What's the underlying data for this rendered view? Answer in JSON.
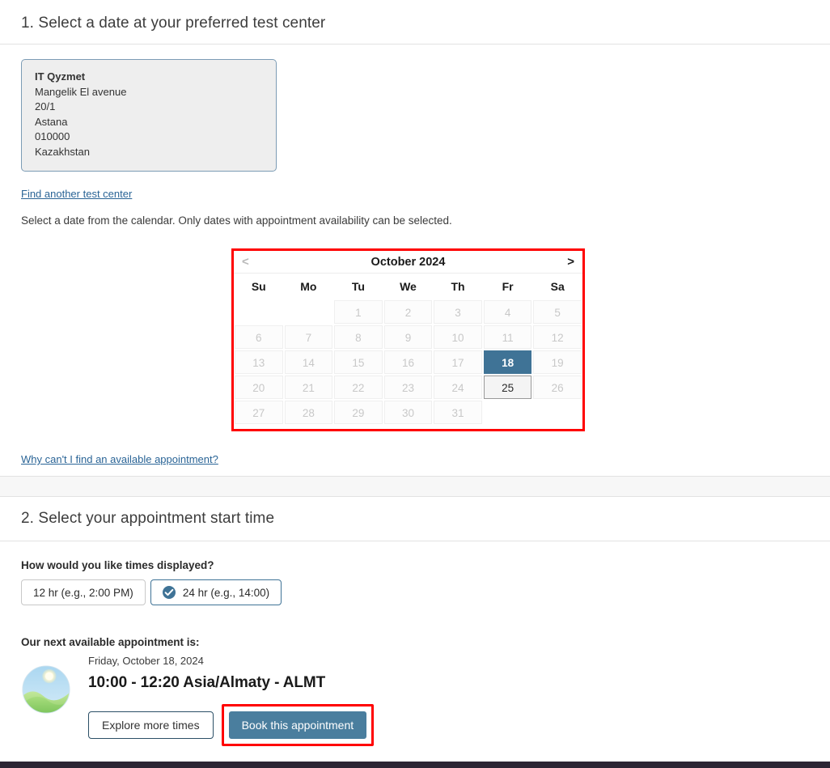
{
  "section1": {
    "heading": "1. Select a date at your preferred test center",
    "test_center": {
      "name": "IT Qyzmet",
      "street": "Mangelik El avenue",
      "building": "20/1",
      "city": "Astana",
      "postal_code": "010000",
      "country": "Kazakhstan"
    },
    "find_another_link": "Find another test center",
    "calendar_instructions": "Select a date from the calendar. Only dates with appointment availability can be selected.",
    "why_link": "Why can't I find an available appointment?"
  },
  "calendar": {
    "title": "October 2024",
    "prev_label": "<",
    "next_label": ">",
    "weekday_headers": [
      "Su",
      "Mo",
      "Tu",
      "We",
      "Th",
      "Fr",
      "Sa"
    ],
    "selected_day": 18,
    "available_days": [
      25
    ],
    "weeks": [
      [
        {
          "label": "",
          "state": "empty"
        },
        {
          "label": "",
          "state": "empty"
        },
        {
          "label": "1",
          "state": "disabled"
        },
        {
          "label": "2",
          "state": "disabled"
        },
        {
          "label": "3",
          "state": "disabled"
        },
        {
          "label": "4",
          "state": "disabled"
        },
        {
          "label": "5",
          "state": "disabled"
        }
      ],
      [
        {
          "label": "6",
          "state": "disabled"
        },
        {
          "label": "7",
          "state": "disabled"
        },
        {
          "label": "8",
          "state": "disabled"
        },
        {
          "label": "9",
          "state": "disabled"
        },
        {
          "label": "10",
          "state": "disabled"
        },
        {
          "label": "11",
          "state": "disabled"
        },
        {
          "label": "12",
          "state": "disabled"
        }
      ],
      [
        {
          "label": "13",
          "state": "disabled"
        },
        {
          "label": "14",
          "state": "disabled"
        },
        {
          "label": "15",
          "state": "disabled"
        },
        {
          "label": "16",
          "state": "disabled"
        },
        {
          "label": "17",
          "state": "disabled"
        },
        {
          "label": "18",
          "state": "selected"
        },
        {
          "label": "19",
          "state": "disabled"
        }
      ],
      [
        {
          "label": "20",
          "state": "disabled"
        },
        {
          "label": "21",
          "state": "disabled"
        },
        {
          "label": "22",
          "state": "disabled"
        },
        {
          "label": "23",
          "state": "disabled"
        },
        {
          "label": "24",
          "state": "disabled"
        },
        {
          "label": "25",
          "state": "available"
        },
        {
          "label": "26",
          "state": "disabled"
        }
      ],
      [
        {
          "label": "27",
          "state": "disabled"
        },
        {
          "label": "28",
          "state": "disabled"
        },
        {
          "label": "29",
          "state": "disabled"
        },
        {
          "label": "30",
          "state": "disabled"
        },
        {
          "label": "31",
          "state": "disabled"
        },
        {
          "label": "",
          "state": "empty"
        },
        {
          "label": "",
          "state": "empty"
        }
      ]
    ]
  },
  "section2": {
    "heading": "2. Select your appointment start time",
    "time_format_question": "How would you like times displayed?",
    "time_format_options": [
      {
        "label": "12 hr (e.g., 2:00 PM)",
        "selected": false
      },
      {
        "label": "24 hr (e.g., 14:00)",
        "selected": true
      }
    ],
    "next_available_label": "Our next available appointment is:",
    "appointment": {
      "date": "Friday, October 18, 2024",
      "time_range": "10:00 - 12:20 Asia/Almaty - ALMT",
      "icon": "morning-sun-icon"
    },
    "explore_button": "Explore more times",
    "book_button": "Book this appointment"
  },
  "colors": {
    "accent_blue": "#4a7e9e",
    "selected_day_blue": "#3f7396",
    "link_blue": "#2a6496",
    "highlight_red": "#ff0000",
    "box_background": "#eeeeee",
    "band_gray": "#f7f7f7",
    "footer_dark": "#2b2433"
  }
}
